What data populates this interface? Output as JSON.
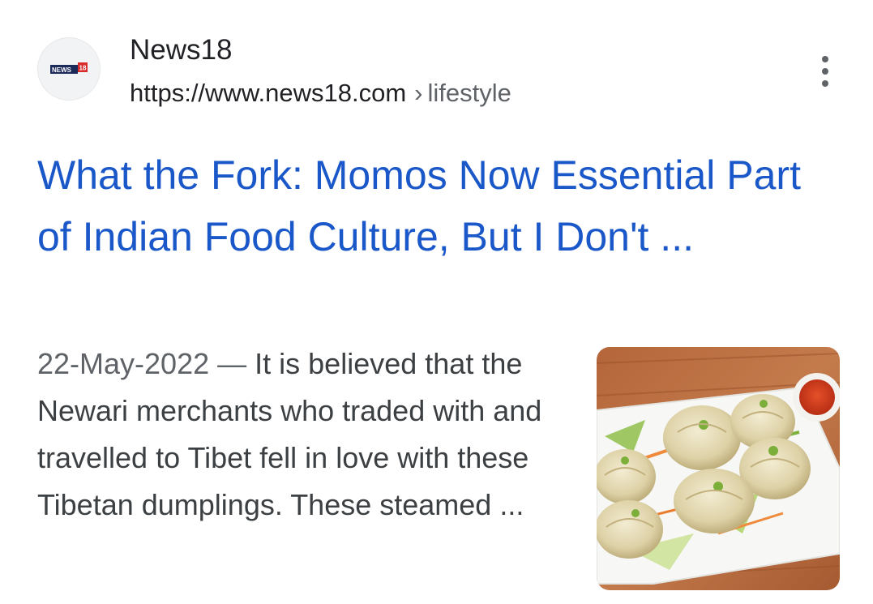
{
  "result": {
    "source": {
      "name": "News18",
      "url_domain": "https://www.news18.com",
      "url_separator": "›",
      "url_path": "lifestyle",
      "favicon_icon": "news18-logo-icon",
      "favicon_text": "NEWS 18"
    },
    "title": "What the Fork: Momos Now Essential Part of Indian Food Culture, But I Don't ...",
    "snippet": {
      "date": "22-May-2022",
      "dash": "—",
      "text": "It is believed that the Newari merchants who traded with and travelled to Tibet fell in love with these Tibetan dumplings. These steamed ..."
    },
    "thumbnail": {
      "icon": "momos-plate-image"
    },
    "more_options_icon": "more-vert-icon"
  },
  "colors": {
    "title_link": "#1a57c8",
    "source_text": "#202124",
    "secondary_text": "#5f6368",
    "snippet_text": "#3c4043",
    "brand_red": "#d92b2b"
  }
}
